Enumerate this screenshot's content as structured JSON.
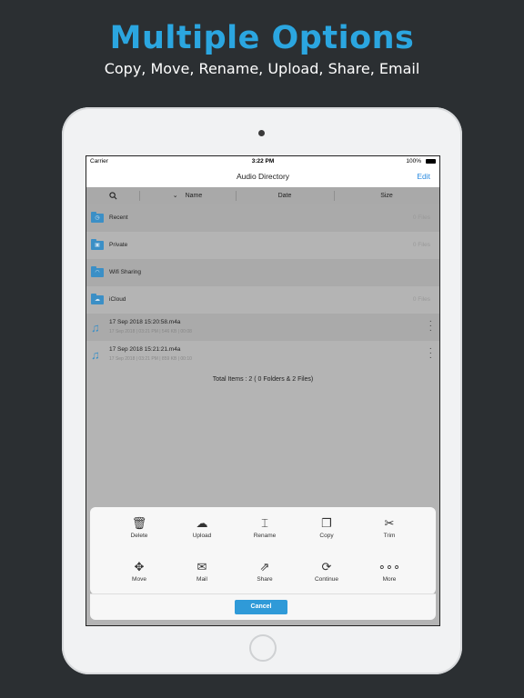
{
  "promo": {
    "headline": "Multiple Options",
    "subline": "Copy, Move, Rename, Upload, Share, Email"
  },
  "status_bar": {
    "carrier": "Carrier",
    "time": "3:22 PM",
    "battery": "100%"
  },
  "nav": {
    "title": "Audio Directory",
    "edit_label": "Edit"
  },
  "columns": {
    "name": "Name",
    "date": "Date",
    "size": "Size",
    "sort_icon": "chevron-down-icon",
    "search_icon": "search-icon"
  },
  "folders": [
    {
      "label": "Recent",
      "count": "0 Files",
      "icon": "clock-icon"
    },
    {
      "label": "Private",
      "count": "0 Files",
      "icon": "lock-icon"
    },
    {
      "label": "Wifi Sharing",
      "count": "",
      "icon": "wifi-icon"
    },
    {
      "label": "iCloud",
      "count": "0 Files",
      "icon": "cloud-icon"
    }
  ],
  "files": [
    {
      "name": "17 Sep 2018 15:20:58.m4a",
      "meta": "17 Sep 2018 | 03:21 PM | 546 KB | 00:08"
    },
    {
      "name": "17 Sep 2018 15:21:21.m4a",
      "meta": "17 Sep 2018 | 03:21 PM | 859 KB | 00:10"
    }
  ],
  "total_text": "Total Items : 2 ( 0 Folders & 2 Files)",
  "actions_row1": [
    {
      "label": "Delete",
      "icon": "trash-icon"
    },
    {
      "label": "Upload",
      "icon": "cloud-upload-icon"
    },
    {
      "label": "Rename",
      "icon": "rename-icon"
    },
    {
      "label": "Copy",
      "icon": "copy-icon"
    },
    {
      "label": "Trim",
      "icon": "scissors-icon"
    }
  ],
  "actions_row2": [
    {
      "label": "Move",
      "icon": "move-icon"
    },
    {
      "label": "Mail",
      "icon": "mail-icon"
    },
    {
      "label": "Share",
      "icon": "share-icon"
    },
    {
      "label": "Continue",
      "icon": "refresh-icon"
    },
    {
      "label": "More",
      "icon": "more-icon"
    }
  ],
  "cancel_label": "Cancel",
  "colors": {
    "accent": "#2BA6E0",
    "folder": "#3B8FC6",
    "background": "#2B2F32",
    "cancel_button": "#2F9AD8"
  }
}
